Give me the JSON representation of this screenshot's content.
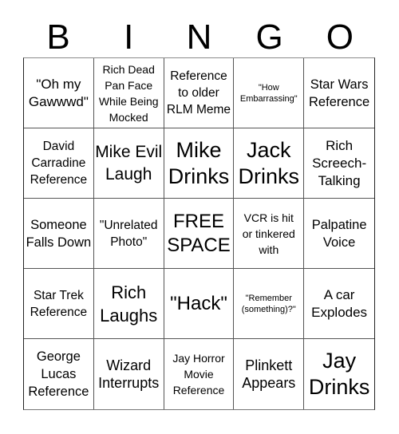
{
  "header": {
    "letters": [
      "B",
      "I",
      "N",
      "G",
      "O"
    ]
  },
  "board": {
    "cells": [
      "\"Oh my Gawwwd\"",
      "Rich Dead Pan Face While Being Mocked",
      "Reference to older RLM Meme",
      "\"How Embarrassing\"",
      "Star Wars Reference",
      "David Carradine Reference",
      "Mike Evil Laugh",
      "Mike Drinks",
      "Jack Drinks",
      "Rich Screech-Talking",
      "Someone Falls Down",
      "\"Unrelated Photo\"",
      "FREE SPACE",
      "VCR is hit or tinkered with",
      "Palpatine Voice",
      "Star Trek Reference",
      "Rich Laughs",
      "\"Hack\"",
      "\"Remember (something)?\"",
      "A car Explodes",
      "George Lucas Reference",
      "Wizard Interrupts",
      "Jay Horror Movie Reference",
      "Plinkett Appears",
      "Jay Drinks"
    ]
  }
}
